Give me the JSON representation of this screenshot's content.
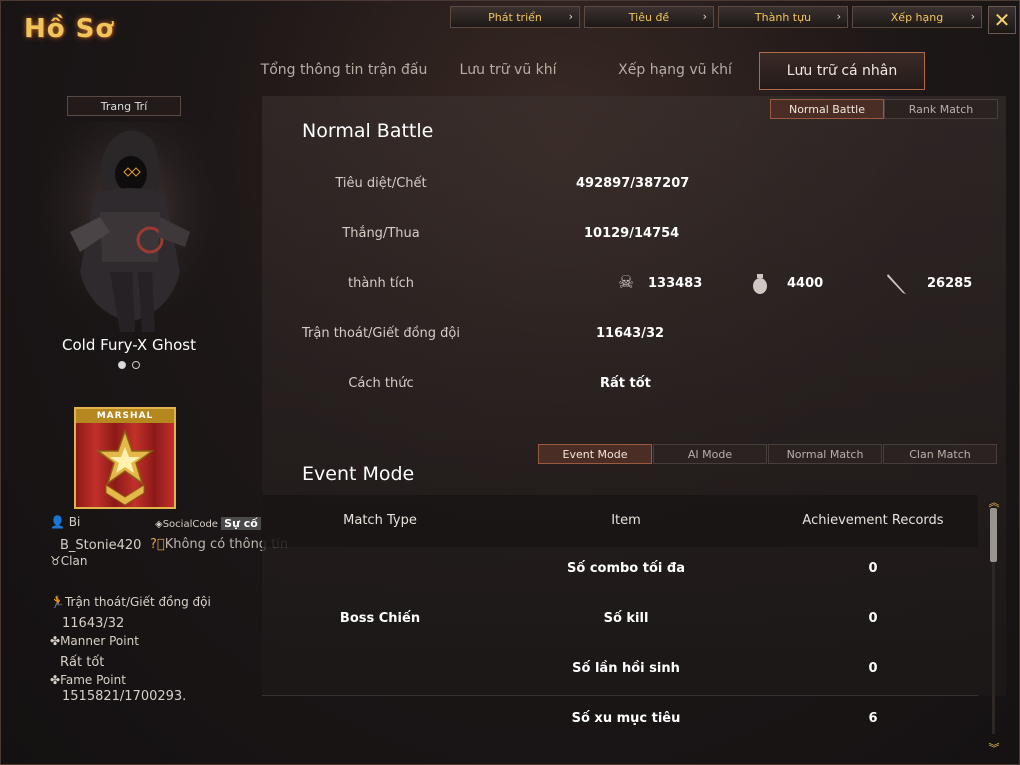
{
  "window": {
    "title": "Hồ Sơ",
    "close_label": "✕"
  },
  "topnav": [
    {
      "label": "Phát triển"
    },
    {
      "label": "Tiêu đề"
    },
    {
      "label": "Thành tựu"
    },
    {
      "label": "Xếp hạng"
    }
  ],
  "tabs": [
    {
      "label": "Tổng thông tin trận đấu"
    },
    {
      "label": "Lưu trữ vũ khí"
    },
    {
      "label": "Xếp hạng vũ khí"
    },
    {
      "label": "Lưu trữ cá nhân",
      "active": true
    }
  ],
  "left": {
    "decor_button": "Trang Trí",
    "character_name": "Cold Fury-X Ghost",
    "rank_label": "MARSHAL",
    "nick_label": "Bi",
    "social_label": "SocialCode",
    "social_value": "Sự cố",
    "username": "B_Stonie420",
    "no_info": "Không có thông tin",
    "clan_label": "Clan",
    "escape_label": "Trận thoát/Giết đồng đội",
    "escape_value": "11643/32",
    "manner_label": "Manner Point",
    "manner_value": "Rất tốt",
    "fame_label": "Fame Point",
    "fame_value": "1515821/1700293."
  },
  "mode_buttons": [
    {
      "label": "Normal Battle",
      "active": true
    },
    {
      "label": "Rank Match"
    }
  ],
  "normal_battle": {
    "title": "Normal Battle",
    "rows": {
      "kd_label": "Tiêu diệt/Chết",
      "kd_value": "492897/387207",
      "wl_label": "Thắng/Thua",
      "wl_value": "10129/14754",
      "ach_label": "thành tích",
      "skull_value": "133483",
      "grenade_value": "4400",
      "knife_value": "26285",
      "escape_label": "Trận thoát/Giết đồng đội",
      "escape_value": "11643/32",
      "style_label": "Cách thức",
      "style_value": "Rất tốt"
    }
  },
  "event_buttons": [
    {
      "label": "Event Mode",
      "active": true
    },
    {
      "label": "AI Mode"
    },
    {
      "label": "Normal Match"
    },
    {
      "label": "Clan Match"
    }
  ],
  "event_mode": {
    "title": "Event Mode",
    "headers": {
      "match_type": "Match Type",
      "item": "Item",
      "records": "Achievement Records"
    },
    "match_type": "Boss Chiến",
    "rows": [
      {
        "item": "Số combo tối đa",
        "value": "0"
      },
      {
        "item": "Số kill",
        "value": "0"
      },
      {
        "item": "Số lần hồi sinh",
        "value": "0"
      },
      {
        "item": "Số xu mục tiêu",
        "value": "6"
      }
    ]
  },
  "colors": {
    "accent": "#f1c55a",
    "active_tab_border": "#b06a4a",
    "panel_bg": "#2a2322"
  },
  "icons": [
    "skull-crossbones-icon",
    "grenade-icon",
    "knife-icon",
    "person-icon",
    "tag-icon",
    "question-icon",
    "clan-icon",
    "running-icon",
    "clover-icon"
  ]
}
